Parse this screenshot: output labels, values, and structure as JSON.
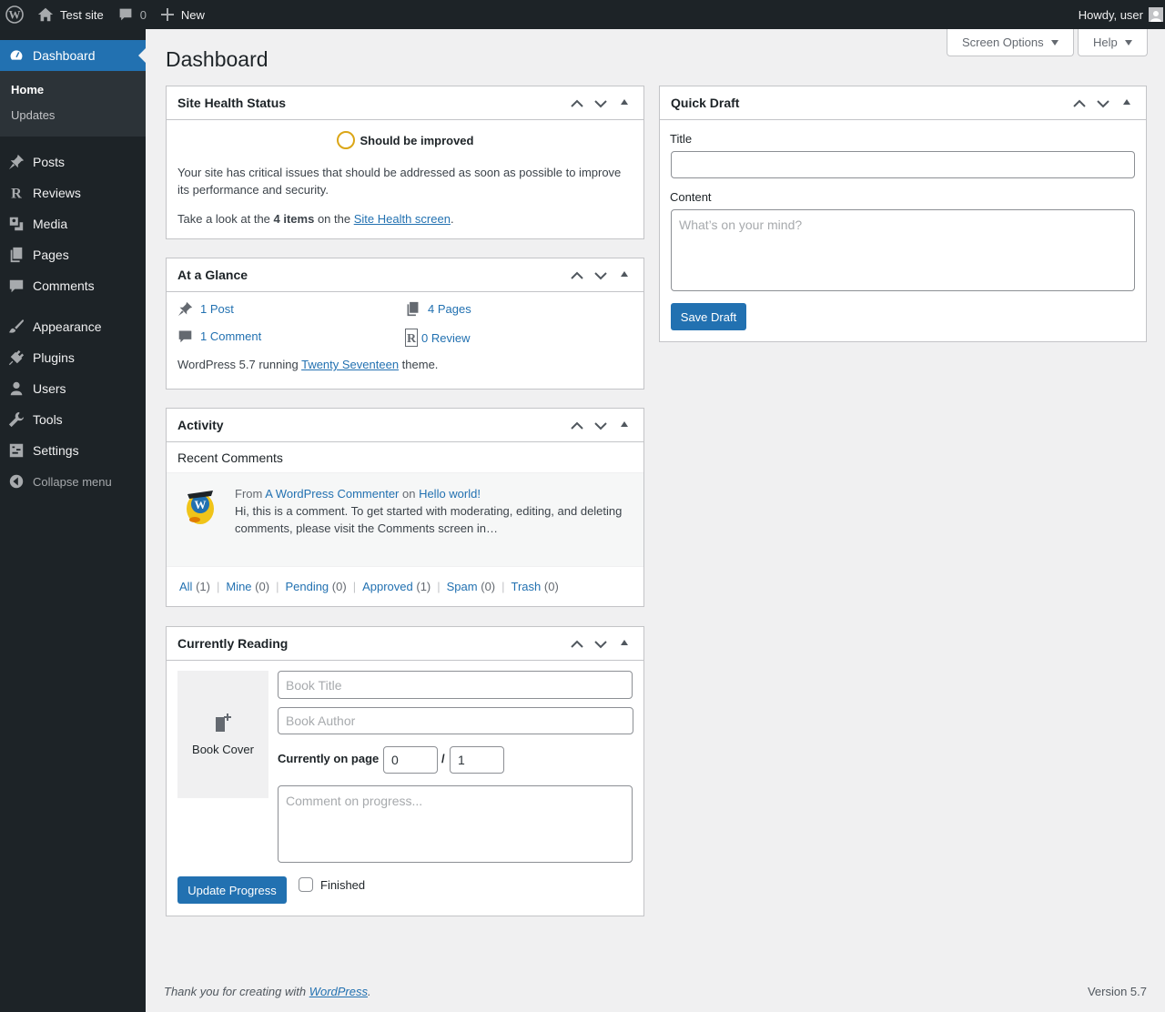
{
  "adminbar": {
    "site_name": "Test site",
    "comment_count": "0",
    "new_label": "New",
    "greeting": "Howdy, user"
  },
  "sidebar": {
    "current": "Dashboard",
    "submenu": [
      {
        "label": "Home"
      },
      {
        "label": "Updates"
      }
    ],
    "items": [
      {
        "label": "Posts",
        "icon": "pin-icon"
      },
      {
        "label": "Reviews",
        "icon": "reviews-icon"
      },
      {
        "label": "Media",
        "icon": "media-icon"
      },
      {
        "label": "Pages",
        "icon": "pages-icon"
      },
      {
        "label": "Comments",
        "icon": "comments-icon"
      },
      {
        "label": "Appearance",
        "icon": "brush-icon"
      },
      {
        "label": "Plugins",
        "icon": "plug-icon"
      },
      {
        "label": "Users",
        "icon": "user-icon"
      },
      {
        "label": "Tools",
        "icon": "wrench-icon"
      },
      {
        "label": "Settings",
        "icon": "settings-icon"
      }
    ],
    "collapse_label": "Collapse menu"
  },
  "page": {
    "title": "Dashboard",
    "screen_options": "Screen Options",
    "help": "Help"
  },
  "site_health": {
    "title": "Site Health Status",
    "status": "Should be improved",
    "description": "Your site has critical issues that should be addressed as soon as possible to improve its performance and security.",
    "text_before": "Take a look at the ",
    "items_count": "4 items",
    "text_middle": " on the ",
    "link": "Site Health screen",
    "text_after": "."
  },
  "glance": {
    "title": "At a Glance",
    "posts": "1 Post",
    "pages": "4 Pages",
    "comments": "1 Comment",
    "reviews": "0 Review",
    "wp_text": "WordPress 5.7 running ",
    "theme": "Twenty Seventeen",
    "theme_suffix": " theme."
  },
  "activity": {
    "title": "Activity",
    "recent_comments": "Recent Comments",
    "comment": {
      "from": "From ",
      "author": "A WordPress Commenter",
      "on": " on ",
      "post": "Hello world!",
      "excerpt": "Hi, this is a comment. To get started with moderating, editing, and deleting comments, please visit the Comments screen in…"
    },
    "filters": [
      {
        "label": "All",
        "count": "(1)"
      },
      {
        "label": "Mine",
        "count": "(0)"
      },
      {
        "label": "Pending",
        "count": "(0)"
      },
      {
        "label": "Approved",
        "count": "(1)"
      },
      {
        "label": "Spam",
        "count": "(0)"
      },
      {
        "label": "Trash",
        "count": "(0)"
      }
    ]
  },
  "reading": {
    "title": "Currently Reading",
    "cover_label": "Book Cover",
    "book_title_placeholder": "Book Title",
    "book_author_placeholder": "Book Author",
    "page_label": "Currently on page",
    "current_page": "0",
    "slash": "/",
    "total_pages": "1",
    "comment_placeholder": "Comment on progress...",
    "update_button": "Update Progress",
    "finished_label": "Finished"
  },
  "quick_draft": {
    "title": "Quick Draft",
    "title_label": "Title",
    "content_label": "Content",
    "content_placeholder": "What’s on your mind?",
    "save_button": "Save Draft"
  },
  "footer": {
    "thanks_prefix": "Thank you for creating with ",
    "wp_link": "WordPress",
    "thanks_suffix": ".",
    "version": "Version 5.7"
  },
  "colors": {
    "admin_bg": "#1d2327",
    "accent": "#2271b1",
    "health_ring": "#dba617"
  }
}
